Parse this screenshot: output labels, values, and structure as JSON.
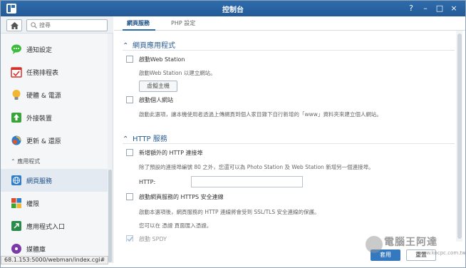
{
  "window": {
    "title": "控制台",
    "controls": [
      "?",
      "–",
      "□",
      "×"
    ]
  },
  "sidebar": {
    "search_placeholder": "搜尋",
    "items": [
      {
        "label": "通知設定",
        "icon": "chat-bubble-icon",
        "color": "#3dbb3b"
      },
      {
        "label": "任務排程表",
        "icon": "calendar-check-icon",
        "color": "#d6302a"
      },
      {
        "label": "硬體 & 電源",
        "icon": "lightbulb-icon",
        "color": "#f2b632"
      },
      {
        "label": "外接裝置",
        "icon": "upload-device-icon",
        "color": "#3aa43a"
      },
      {
        "label": "更新 & 還原",
        "icon": "update-restore-icon",
        "color": "#e0562a"
      }
    ],
    "group_label": "應用程式",
    "app_items": [
      {
        "label": "網頁服務",
        "icon": "web-globe-icon",
        "color": "#2f7dc9",
        "active": true
      },
      {
        "label": "權限",
        "icon": "permission-grid-icon",
        "color": "#e04a2a"
      },
      {
        "label": "應用程式入口",
        "icon": "app-portal-icon",
        "color": "#2a8a4a"
      },
      {
        "label": "媒體庫",
        "icon": "media-library-icon",
        "color": "#7a3aa8"
      }
    ]
  },
  "tabs": [
    {
      "label": "網頁服務",
      "active": true
    },
    {
      "label": "PHP 設定",
      "active": false
    }
  ],
  "web_apps": {
    "heading": "網頁應用程式",
    "enable_ws_label": "啟動Web Station",
    "enable_ws_desc": "啟動Web Station 以建立網站。",
    "vhost_button": "虛擬主機",
    "personal_site_label": "啟動個人網站",
    "personal_site_desc": "啟動此選項，讓本機使用者透過上傳網頁到個人家目錄下自行新增的「www」資料夾來建立個人網站。"
  },
  "http": {
    "heading": "HTTP 服務",
    "extra_port_label": "新增額外的 HTTP 連接埠",
    "extra_port_desc": "除了預設的連接埠編號 80 之外，您還可以為 Photo Station 及 Web Station 新增另一個連接埠。",
    "http_field_label": "HTTP:",
    "https_label": "啟動網頁服務的 HTTPS 安全連線",
    "https_desc1": "啟動本選項後，網頁服務的 HTTP 連線將會受到 SSL/TLS 安全連線的保護。",
    "https_desc2": "您可以在 憑證 頁面匯入憑證。",
    "spdy_label": "啟動 SPDY"
  },
  "footer": {
    "apply": "套用",
    "reset": "重置"
  },
  "statusbar": "68.1.153:5000/webman/index.cgi#",
  "watermark": {
    "text": "電腦王阿達",
    "url": "www.kocpc.com.tw"
  }
}
